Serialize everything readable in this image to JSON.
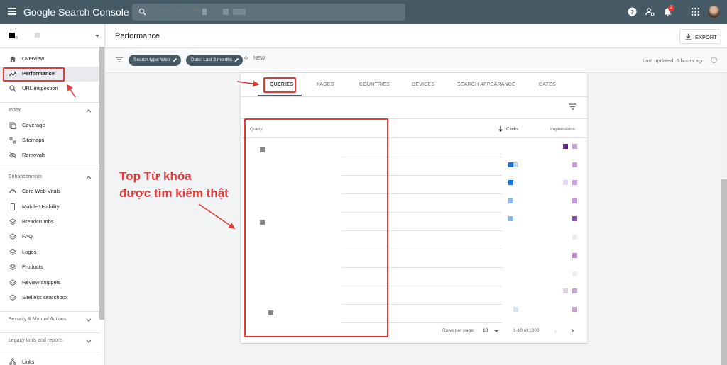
{
  "app": {
    "title": "Google Search Console"
  },
  "search": {
    "placeholder": "Inspect any URL in"
  },
  "notifications": {
    "count": "2"
  },
  "sidebar": {
    "overview": "Overview",
    "performance": "Performance",
    "url_inspection": "URL inspection",
    "index": {
      "title": "Index",
      "items": [
        "Coverage",
        "Sitemaps",
        "Removals"
      ]
    },
    "enhancements": {
      "title": "Enhancements",
      "items": [
        "Core Web Vitals",
        "Mobile Usability",
        "Breadcrumbs",
        "FAQ",
        "Logos",
        "Products",
        "Review snippets",
        "Sitelinks searchbox"
      ]
    },
    "security": "Security & Manual Actions",
    "legacy": "Legacy tools and reports",
    "links": "Links"
  },
  "header": {
    "title": "Performance",
    "export_label": "EXPORT"
  },
  "filters": {
    "search_type": "Search type: Web",
    "date": "Date: Last 3 months",
    "new_label": "NEW",
    "last_updated": "Last updated: 6 hours ago"
  },
  "tabs": [
    "QUERIES",
    "PAGES",
    "COUNTRIES",
    "DEVICES",
    "SEARCH APPEARANCE",
    "DATES"
  ],
  "active_tab": "QUERIES",
  "table": {
    "col_query": "Query",
    "col_clicks": "Clicks",
    "col_impressions": "Impressions",
    "rows_per_page_label": "Rows per page:",
    "rows_per_page_value": "10",
    "range": "1-10 of 1000"
  },
  "annotation": {
    "line1": "Top Từ khóa",
    "line2": "được tìm kiếm thật",
    "color": "#e53935"
  },
  "colors": {
    "topbar": "#455a64",
    "accent": "#455a64",
    "annotation": "#e53935"
  }
}
